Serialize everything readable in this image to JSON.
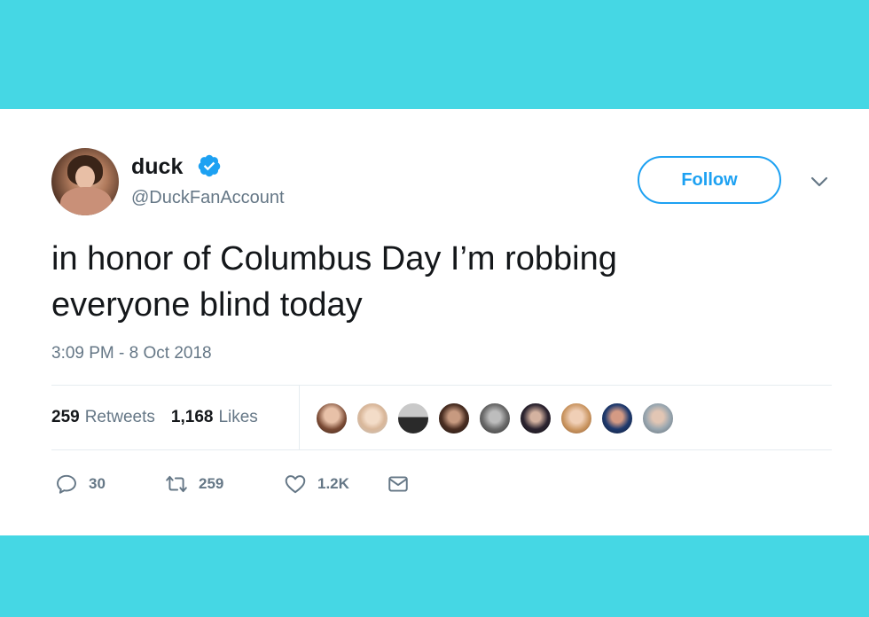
{
  "tweet": {
    "display_name": "duck",
    "handle": "@DuckFanAccount",
    "follow_label": "Follow",
    "text_line1": "in honor of Columbus Day I’m robbing",
    "text_line2": "everyone blind today",
    "timestamp": "3:09 PM - 8 Oct 2018"
  },
  "stats": {
    "retweets_count": "259",
    "retweets_label": "Retweets",
    "likes_count": "1,168",
    "likes_label": "Likes"
  },
  "actions": {
    "replies": "30",
    "retweets": "259",
    "likes": "1.2K"
  },
  "colors": {
    "background": "#45d7e4",
    "accent": "#1da1f2",
    "text": "#14171a",
    "muted": "#657786"
  },
  "icons": [
    "verified-badge-icon",
    "chevron-down-icon",
    "reply-icon",
    "retweet-icon",
    "like-icon",
    "direct-message-icon"
  ]
}
